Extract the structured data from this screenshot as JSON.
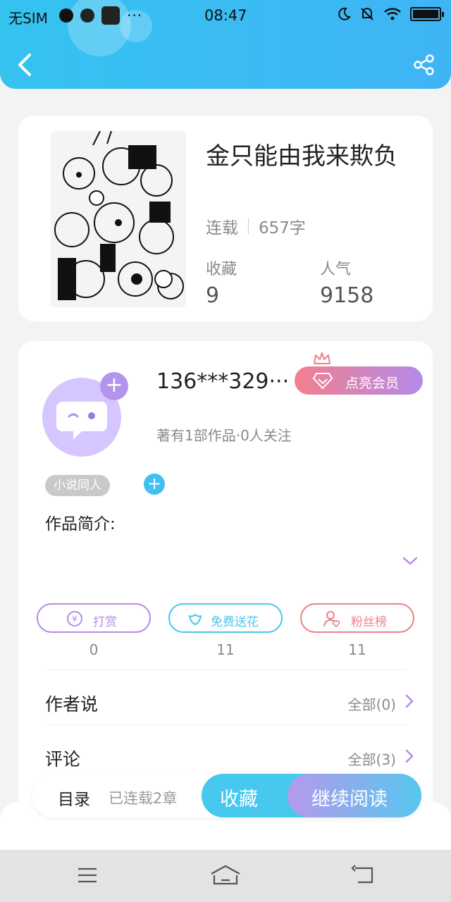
{
  "status_bar": {
    "carrier": "无SIM",
    "time": "08:47",
    "more": "···"
  },
  "book": {
    "title": "金只能由我来欺负",
    "status": "连载",
    "word_count": "657字",
    "favorites_label": "收藏",
    "favorites_value": "9",
    "popularity_label": "人气",
    "popularity_value": "9158"
  },
  "author": {
    "name": "136***329···",
    "vip_label": "点亮会员",
    "summary": "著有1部作品·0人关注",
    "tag": "小说同人",
    "intro_label": "作品简介:"
  },
  "actions": [
    {
      "label": "打赏",
      "count": "0",
      "icon": "coin-icon",
      "color": "#b48be8"
    },
    {
      "label": "免费送花",
      "count": "11",
      "icon": "flower-icon",
      "color": "#47c8ef"
    },
    {
      "label": "粉丝榜",
      "count": "11",
      "icon": "fan-icon",
      "color": "#f07f8a"
    }
  ],
  "rows": [
    {
      "label": "作者说",
      "link": "全部(0)"
    },
    {
      "label": "评论",
      "link": "全部(3)"
    }
  ],
  "bottom_bar": {
    "toc_label": "目录",
    "toc_sub": "已连载2章",
    "collect_label": "收藏",
    "read_label": "继续阅读"
  },
  "colors": {
    "header": "#3fb4f5",
    "accent_blue": "#47c8ef",
    "accent_purple": "#b48be8",
    "accent_red": "#f07f8a"
  }
}
